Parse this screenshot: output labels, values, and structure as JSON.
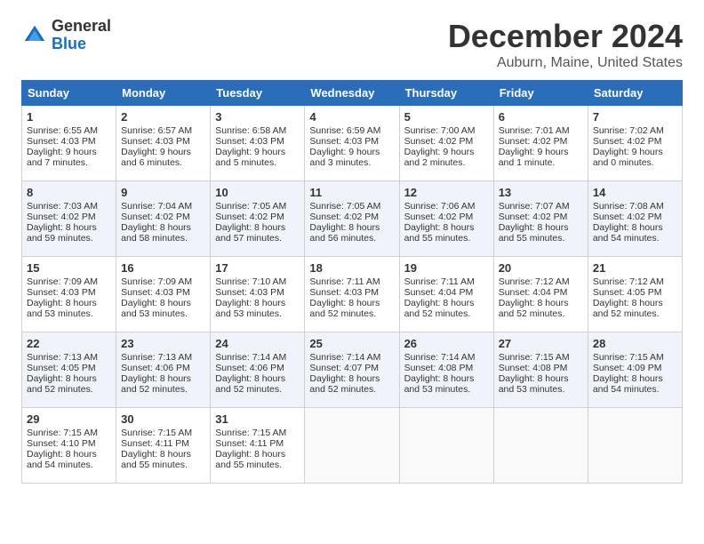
{
  "logo": {
    "general": "General",
    "blue": "Blue"
  },
  "title": "December 2024",
  "location": "Auburn, Maine, United States",
  "days_of_week": [
    "Sunday",
    "Monday",
    "Tuesday",
    "Wednesday",
    "Thursday",
    "Friday",
    "Saturday"
  ],
  "weeks": [
    [
      {
        "day": "1",
        "sunrise": "Sunrise: 6:55 AM",
        "sunset": "Sunset: 4:03 PM",
        "daylight": "Daylight: 9 hours and 7 minutes."
      },
      {
        "day": "2",
        "sunrise": "Sunrise: 6:57 AM",
        "sunset": "Sunset: 4:03 PM",
        "daylight": "Daylight: 9 hours and 6 minutes."
      },
      {
        "day": "3",
        "sunrise": "Sunrise: 6:58 AM",
        "sunset": "Sunset: 4:03 PM",
        "daylight": "Daylight: 9 hours and 5 minutes."
      },
      {
        "day": "4",
        "sunrise": "Sunrise: 6:59 AM",
        "sunset": "Sunset: 4:03 PM",
        "daylight": "Daylight: 9 hours and 3 minutes."
      },
      {
        "day": "5",
        "sunrise": "Sunrise: 7:00 AM",
        "sunset": "Sunset: 4:02 PM",
        "daylight": "Daylight: 9 hours and 2 minutes."
      },
      {
        "day": "6",
        "sunrise": "Sunrise: 7:01 AM",
        "sunset": "Sunset: 4:02 PM",
        "daylight": "Daylight: 9 hours and 1 minute."
      },
      {
        "day": "7",
        "sunrise": "Sunrise: 7:02 AM",
        "sunset": "Sunset: 4:02 PM",
        "daylight": "Daylight: 9 hours and 0 minutes."
      }
    ],
    [
      {
        "day": "8",
        "sunrise": "Sunrise: 7:03 AM",
        "sunset": "Sunset: 4:02 PM",
        "daylight": "Daylight: 8 hours and 59 minutes."
      },
      {
        "day": "9",
        "sunrise": "Sunrise: 7:04 AM",
        "sunset": "Sunset: 4:02 PM",
        "daylight": "Daylight: 8 hours and 58 minutes."
      },
      {
        "day": "10",
        "sunrise": "Sunrise: 7:05 AM",
        "sunset": "Sunset: 4:02 PM",
        "daylight": "Daylight: 8 hours and 57 minutes."
      },
      {
        "day": "11",
        "sunrise": "Sunrise: 7:05 AM",
        "sunset": "Sunset: 4:02 PM",
        "daylight": "Daylight: 8 hours and 56 minutes."
      },
      {
        "day": "12",
        "sunrise": "Sunrise: 7:06 AM",
        "sunset": "Sunset: 4:02 PM",
        "daylight": "Daylight: 8 hours and 55 minutes."
      },
      {
        "day": "13",
        "sunrise": "Sunrise: 7:07 AM",
        "sunset": "Sunset: 4:02 PM",
        "daylight": "Daylight: 8 hours and 55 minutes."
      },
      {
        "day": "14",
        "sunrise": "Sunrise: 7:08 AM",
        "sunset": "Sunset: 4:02 PM",
        "daylight": "Daylight: 8 hours and 54 minutes."
      }
    ],
    [
      {
        "day": "15",
        "sunrise": "Sunrise: 7:09 AM",
        "sunset": "Sunset: 4:03 PM",
        "daylight": "Daylight: 8 hours and 53 minutes."
      },
      {
        "day": "16",
        "sunrise": "Sunrise: 7:09 AM",
        "sunset": "Sunset: 4:03 PM",
        "daylight": "Daylight: 8 hours and 53 minutes."
      },
      {
        "day": "17",
        "sunrise": "Sunrise: 7:10 AM",
        "sunset": "Sunset: 4:03 PM",
        "daylight": "Daylight: 8 hours and 53 minutes."
      },
      {
        "day": "18",
        "sunrise": "Sunrise: 7:11 AM",
        "sunset": "Sunset: 4:03 PM",
        "daylight": "Daylight: 8 hours and 52 minutes."
      },
      {
        "day": "19",
        "sunrise": "Sunrise: 7:11 AM",
        "sunset": "Sunset: 4:04 PM",
        "daylight": "Daylight: 8 hours and 52 minutes."
      },
      {
        "day": "20",
        "sunrise": "Sunrise: 7:12 AM",
        "sunset": "Sunset: 4:04 PM",
        "daylight": "Daylight: 8 hours and 52 minutes."
      },
      {
        "day": "21",
        "sunrise": "Sunrise: 7:12 AM",
        "sunset": "Sunset: 4:05 PM",
        "daylight": "Daylight: 8 hours and 52 minutes."
      }
    ],
    [
      {
        "day": "22",
        "sunrise": "Sunrise: 7:13 AM",
        "sunset": "Sunset: 4:05 PM",
        "daylight": "Daylight: 8 hours and 52 minutes."
      },
      {
        "day": "23",
        "sunrise": "Sunrise: 7:13 AM",
        "sunset": "Sunset: 4:06 PM",
        "daylight": "Daylight: 8 hours and 52 minutes."
      },
      {
        "day": "24",
        "sunrise": "Sunrise: 7:14 AM",
        "sunset": "Sunset: 4:06 PM",
        "daylight": "Daylight: 8 hours and 52 minutes."
      },
      {
        "day": "25",
        "sunrise": "Sunrise: 7:14 AM",
        "sunset": "Sunset: 4:07 PM",
        "daylight": "Daylight: 8 hours and 52 minutes."
      },
      {
        "day": "26",
        "sunrise": "Sunrise: 7:14 AM",
        "sunset": "Sunset: 4:08 PM",
        "daylight": "Daylight: 8 hours and 53 minutes."
      },
      {
        "day": "27",
        "sunrise": "Sunrise: 7:15 AM",
        "sunset": "Sunset: 4:08 PM",
        "daylight": "Daylight: 8 hours and 53 minutes."
      },
      {
        "day": "28",
        "sunrise": "Sunrise: 7:15 AM",
        "sunset": "Sunset: 4:09 PM",
        "daylight": "Daylight: 8 hours and 54 minutes."
      }
    ],
    [
      {
        "day": "29",
        "sunrise": "Sunrise: 7:15 AM",
        "sunset": "Sunset: 4:10 PM",
        "daylight": "Daylight: 8 hours and 54 minutes."
      },
      {
        "day": "30",
        "sunrise": "Sunrise: 7:15 AM",
        "sunset": "Sunset: 4:11 PM",
        "daylight": "Daylight: 8 hours and 55 minutes."
      },
      {
        "day": "31",
        "sunrise": "Sunrise: 7:15 AM",
        "sunset": "Sunset: 4:11 PM",
        "daylight": "Daylight: 8 hours and 55 minutes."
      },
      null,
      null,
      null,
      null
    ]
  ]
}
